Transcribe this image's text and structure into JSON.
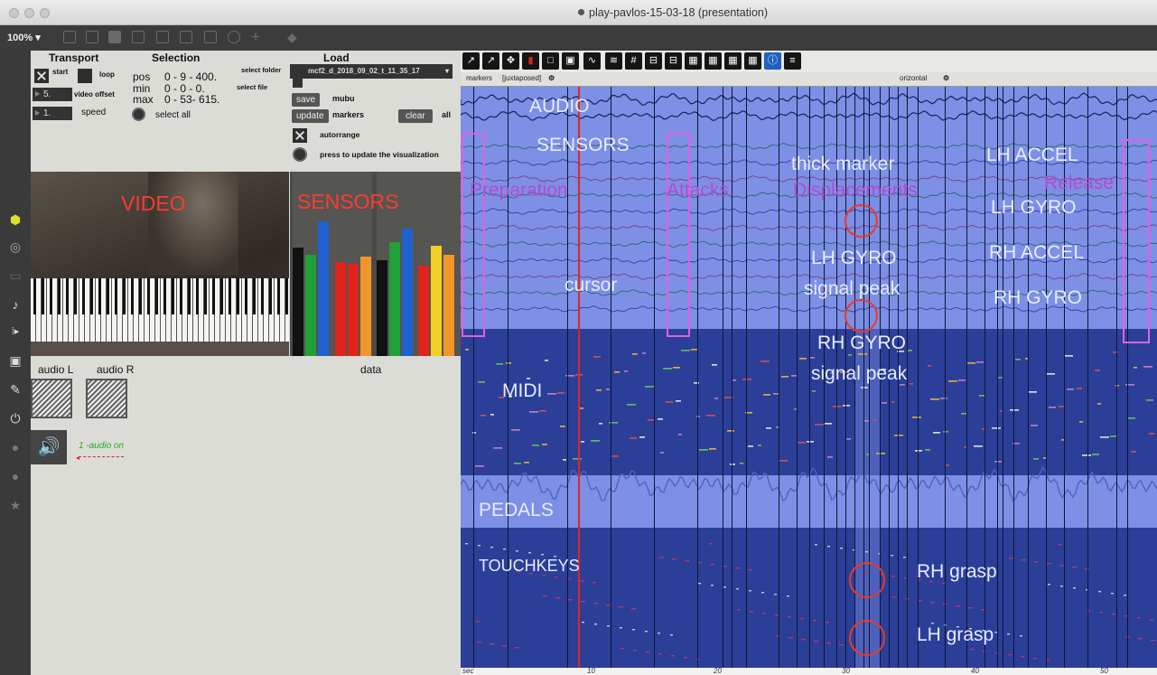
{
  "window": {
    "title": "play-pavlos-15-03-18 (presentation)"
  },
  "toolbar": {
    "zoom": "100%",
    "zoom_arrow": "▾"
  },
  "transport": {
    "header": "Transport",
    "start_label": "start",
    "loop_label": "loop",
    "video_offset_value": "5.",
    "video_offset_label": "video offset",
    "speed_value": "1.",
    "speed_label": "speed"
  },
  "selection": {
    "header": "Selection",
    "pos_label": "pos",
    "pos_value": "0  - 9  - 400.",
    "min_label": "min",
    "min_value": "0  - 0  - 0.",
    "max_label": "max",
    "max_value": "0  - 53- 615.",
    "select_all_label": "select all"
  },
  "load": {
    "header": "Load",
    "select_folder_label": "select folder",
    "select_file_label": "select file",
    "menu_value": "mcf2_d_2018_09_02_t_11_35_17",
    "menu_arrow": "▾",
    "save_label": "save",
    "mubu_label": "mubu",
    "update_label": "update",
    "markers_label": "markers",
    "clear_label": "clear",
    "all_label": "all",
    "autorrange_label": "autorrange",
    "press_update_label": "press to update the visualization"
  },
  "video_panel": {
    "overlay": "VIDEO"
  },
  "sensors_panel": {
    "overlay": "SENSORS",
    "bars": [
      {
        "level": 0.59,
        "color": "#111111"
      },
      {
        "level": 0.55,
        "color": "#1fa038"
      },
      {
        "level": 0.73,
        "color": "#1f62d0"
      },
      {
        "level": 0.51,
        "color": "#e0241c"
      },
      {
        "level": 0.5,
        "color": "#e0241c"
      },
      {
        "level": 0.54,
        "color": "#f0962a"
      },
      {
        "level": 0.52,
        "color": "#111111"
      },
      {
        "level": 0.62,
        "color": "#1fa038"
      },
      {
        "level": 0.69,
        "color": "#1f62d0"
      },
      {
        "level": 0.49,
        "color": "#e0241c"
      },
      {
        "level": 0.6,
        "color": "#f0d020"
      },
      {
        "level": 0.55,
        "color": "#f0962a"
      }
    ]
  },
  "audio_panel": {
    "audio_l_label": "audio L",
    "audio_r_label": "audio R",
    "data_label": "data",
    "audio_on_label": "1 -audio on"
  },
  "viz_tools": {
    "tab_markers": "markers",
    "tab_juxtaposed": "[juxtaposed]",
    "tab_horizontal": "orizontal"
  },
  "tracks": {
    "audio": "AUDIO",
    "sensors": "SENSORS",
    "midi": "MIDI",
    "pedals": "PEDALS",
    "touchkeys": "TOUCHKEYS",
    "cursor": "cursor"
  },
  "annotations": {
    "preparation": "Preparation",
    "attacks": "Attacks",
    "displacements": "Displacements",
    "release": "Release",
    "thick_marker": "thick marker",
    "lh_accel": "LH ACCEL",
    "lh_gyro": "LH GYRO",
    "rh_accel": "RH ACCEL",
    "rh_gyro": "RH GYRO",
    "lh_gyro_peak_1": "LH GYRO",
    "lh_gyro_peak_2": "signal peak",
    "rh_gyro_peak_1": "RH GYRO",
    "rh_gyro_peak_2": "signal peak",
    "rh_grasp": "RH grasp",
    "lh_grasp": "LH grasp"
  },
  "ruler": {
    "unit": "sec",
    "ticks": [
      "10",
      "20",
      "30",
      "40",
      "50"
    ]
  },
  "colors": {
    "track_bg": "#2b3f99",
    "audio_bg": "#7d90e6",
    "cursor": "#e8221a",
    "marker_magenta": "#e060e0",
    "annotation_red": "#e83a2a"
  }
}
